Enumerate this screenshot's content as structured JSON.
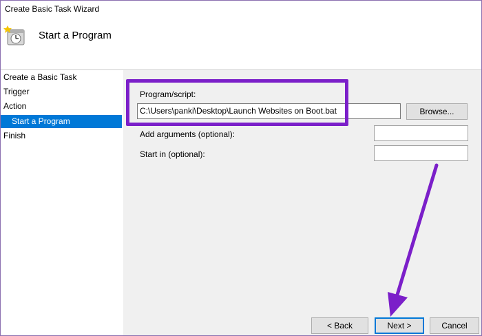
{
  "window": {
    "title": "Create Basic Task Wizard"
  },
  "header": {
    "heading": "Start a Program"
  },
  "nav": {
    "items": [
      {
        "label": "Create a Basic Task"
      },
      {
        "label": "Trigger"
      },
      {
        "label": "Action"
      },
      {
        "label": "Start a Program"
      },
      {
        "label": "Finish"
      }
    ]
  },
  "form": {
    "program_label": "Program/script:",
    "program_value": "C:\\Users\\panki\\Desktop\\Launch Websites on Boot.bat",
    "browse_label": "Browse...",
    "arguments_label": "Add arguments (optional):",
    "arguments_value": "",
    "start_in_label": "Start in (optional):",
    "start_in_value": ""
  },
  "footer": {
    "back_label": "< Back",
    "next_label": "Next >",
    "cancel_label": "Cancel"
  },
  "colors": {
    "annotation": "#7b1fc9",
    "selection": "#0078d7"
  },
  "icons": {
    "header_icon": "task-scheduler-icon"
  }
}
